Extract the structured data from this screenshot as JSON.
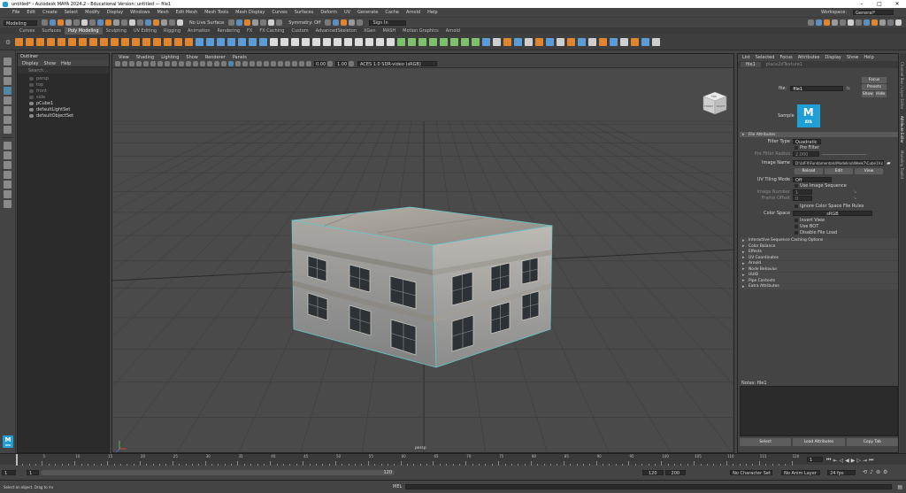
{
  "window": {
    "title": "untitled* - Autodesk MAYA 2024.2 - Educational Version: untitled  —  file1"
  },
  "menubar": {
    "items": [
      "File",
      "Edit",
      "Create",
      "Select",
      "Modify",
      "Display",
      "Windows",
      "Mesh",
      "Edit Mesh",
      "Mesh Tools",
      "Mesh Display",
      "Curves",
      "Surfaces",
      "Deform",
      "UV",
      "Generate",
      "Cache",
      "Arnold",
      "Help"
    ],
    "workspace_label": "Workspace:",
    "workspace_value": "General*"
  },
  "statusline": {
    "menuset": "Modeling",
    "live_surface": "No Live Surface",
    "symmetry": "Symmetry: Off",
    "signin": "Sign In"
  },
  "shelf": {
    "tabs": [
      "Curves",
      "Surfaces",
      "Poly Modeling",
      "Sculpting",
      "UV Editing",
      "Rigging",
      "Animation",
      "Rendering",
      "FX",
      "FX Caching",
      "Custom",
      "AdvancedSkeleton",
      "XGen",
      "MASH",
      "Motion Graphics",
      "Arnold"
    ],
    "active_tab": "Poly Modeling"
  },
  "outliner": {
    "title": "Outliner",
    "menus": [
      "Display",
      "Show",
      "Help"
    ],
    "search_placeholder": "Search...",
    "items": [
      {
        "label": "persp",
        "dim": true
      },
      {
        "label": "top",
        "dim": true
      },
      {
        "label": "front",
        "dim": true
      },
      {
        "label": "side",
        "dim": true
      },
      {
        "label": "pCube1",
        "dim": false
      },
      {
        "label": "defaultLightSet",
        "dim": false
      },
      {
        "label": "defaultObjectSet",
        "dim": false
      }
    ]
  },
  "viewport": {
    "menus": [
      "View",
      "Shading",
      "Lighting",
      "Show",
      "Renderer",
      "Panels"
    ],
    "camera_label": "persp",
    "field_a": "0.00",
    "field_b": "1.00",
    "colorspace": "ACES 1.0 SDR-video (sRGB)",
    "cube_front": "FRONT",
    "cube_right": "RIGHT",
    "cube_top": "TOP"
  },
  "attribute_editor": {
    "menus": [
      "List",
      "Selected",
      "Focus",
      "Attributes",
      "Display",
      "Show",
      "Help"
    ],
    "tabs": [
      "file1",
      "place2dTexture1"
    ],
    "node_label": "file:",
    "node_name": "file1",
    "focus_btn": "Focus",
    "presets_btn": "Presets",
    "show_btn": "Show",
    "hide_btn": "Hide",
    "sample_label": "Sample",
    "logo_text": "AYA",
    "file_attributes_header": "File Attributes",
    "filter_type_label": "Filter Type",
    "filter_type_value": "Quadratic",
    "pre_filter": "Pre Filter",
    "pre_filter_radius_label": "Pre Filter Radius",
    "pre_filter_radius_value": "2.000",
    "image_name_label": "Image Name",
    "image_name_value": "D:\\LVFX\\Fundamentals\\Modeling\\Week7\\Cube1V.png",
    "reload_btn": "Reload",
    "edit_btn": "Edit",
    "view_btn": "View",
    "uv_tiling_label": "UV Tiling Mode",
    "uv_tiling_value": "Off",
    "use_image_sequence": "Use Image Sequence",
    "image_number_label": "Image Number",
    "image_number_value": "1",
    "frame_offset_label": "Frame Offset",
    "frame_offset_value": "0",
    "ignore_cs": "Ignore Color Space File Rules",
    "color_space_label": "Color Space",
    "color_space_value": "sRGB",
    "invert_view": "Invert View",
    "use_bot": "Use BOT",
    "disable_file_load": "Disable File Load",
    "sections": [
      "Interactive Sequence Caching Options",
      "Color Balance",
      "Effects",
      "UV Coordinates",
      "Arnold",
      "Node Behavior",
      "UUID",
      "Pipe Contexts",
      "Extra Attributes"
    ],
    "notes_label": "Notes:  file1",
    "select_btn": "Select",
    "load_attributes_btn": "Load Attributes",
    "copy_tab_btn": "Copy Tab"
  },
  "side_tabs": [
    "Channel Box / Layer Editor",
    "Attribute Editor",
    "Modeling Toolkit"
  ],
  "timeslider": {
    "ticks": [
      "5",
      "10",
      "15",
      "20",
      "25",
      "30",
      "35",
      "40",
      "45",
      "50",
      "55",
      "60",
      "65",
      "70",
      "75",
      "80",
      "85",
      "90",
      "95",
      "100",
      "105",
      "110",
      "115",
      "120"
    ],
    "current_frame": "1"
  },
  "rangeslider": {
    "start": "1",
    "range_start": "1",
    "range_end": "120",
    "end": "120",
    "max": "200",
    "character_set": "No Character Set",
    "anim_layer": "No Anim Layer",
    "fps": "24 fps"
  },
  "help_line": {
    "mode": "MEL",
    "text": "Select an object. Drag to move object(s). Ctrl+middle drag to move components along normals. Shift+drag manipulators axis or plane handles to extrude components or clone objects. Ctrl+Shift+drag to constrain movement to a co..."
  },
  "colors": {
    "accent": "#5285a6",
    "shelf_orange": "#e0852d",
    "selection_teal": "#67c6c9",
    "maya_logo": "#1e9fd6"
  }
}
